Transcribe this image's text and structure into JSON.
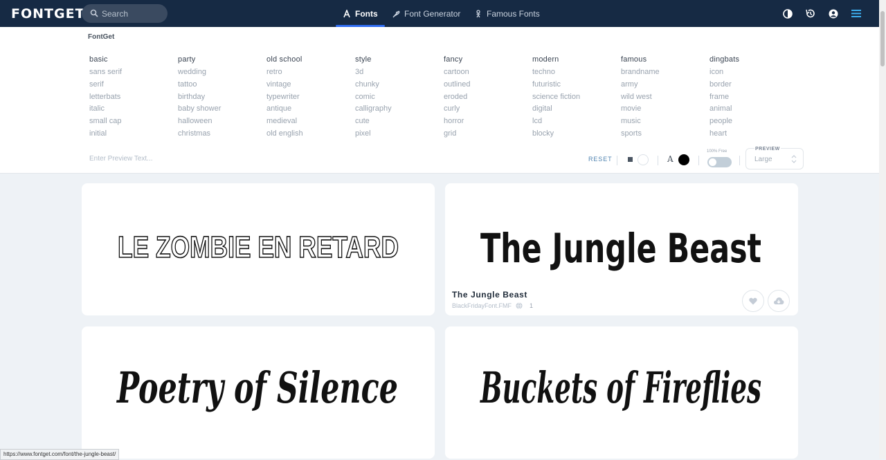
{
  "topbar": {
    "logo": "FONTGET",
    "search_placeholder": "Search",
    "nav": [
      {
        "label": "Fonts",
        "icon": "font-icon",
        "active": true
      },
      {
        "label": "Font Generator",
        "icon": "feather-icon",
        "active": false
      },
      {
        "label": "Famous Fonts",
        "icon": "person-icon",
        "active": false
      }
    ],
    "icons": [
      "contrast-icon",
      "history-icon",
      "account-icon",
      "menu-icon"
    ]
  },
  "menu": {
    "brand": "FontGet",
    "columns": [
      {
        "head": "basic",
        "items": [
          "sans serif",
          "serif",
          "letterbats",
          "italic",
          "small cap",
          "initial"
        ]
      },
      {
        "head": "party",
        "items": [
          "wedding",
          "tattoo",
          "birthday",
          "baby shower",
          "halloween",
          "christmas"
        ]
      },
      {
        "head": "old school",
        "items": [
          "retro",
          "vintage",
          "typewriter",
          "antique",
          "medieval",
          "old english"
        ]
      },
      {
        "head": "style",
        "items": [
          "3d",
          "chunky",
          "comic",
          "calligraphy",
          "cute",
          "pixel"
        ]
      },
      {
        "head": "fancy",
        "items": [
          "cartoon",
          "outlined",
          "eroded",
          "curly",
          "horror",
          "grid"
        ]
      },
      {
        "head": "modern",
        "items": [
          "techno",
          "futuristic",
          "science fiction",
          "digital",
          "lcd",
          "blocky"
        ]
      },
      {
        "head": "famous",
        "items": [
          "brandname",
          "army",
          "wild west",
          "movie",
          "music",
          "sports"
        ]
      },
      {
        "head": "dingbats",
        "items": [
          "icon",
          "border",
          "frame",
          "animal",
          "people",
          "heart"
        ]
      }
    ],
    "preview_placeholder": "Enter Preview Text...",
    "reset_label": "RESET",
    "color_glyph": "A",
    "free_label": "100% Free",
    "preview_label": "PREVIEW",
    "preview_value": "Large"
  },
  "cards": [
    {
      "preview_text": "LE ZOMBIE EN RETARD"
    },
    {
      "preview_text": "The Jungle Beast",
      "name": "The Jungle Beast",
      "author": "BlackFridayFont.FMF",
      "count": "1",
      "icons": [
        "heart-icon",
        "cloud-download-icon"
      ]
    },
    {
      "preview_text": "Poetry of Silence"
    },
    {
      "preview_text": "Buckets of Fireflies"
    }
  ],
  "statusbar": {
    "url": "https://www.fontget.com/font/the-jungle-beast/"
  },
  "colors": {
    "topbar": "#162a44",
    "accent": "#2f6df2",
    "background": "#eef2f6"
  }
}
